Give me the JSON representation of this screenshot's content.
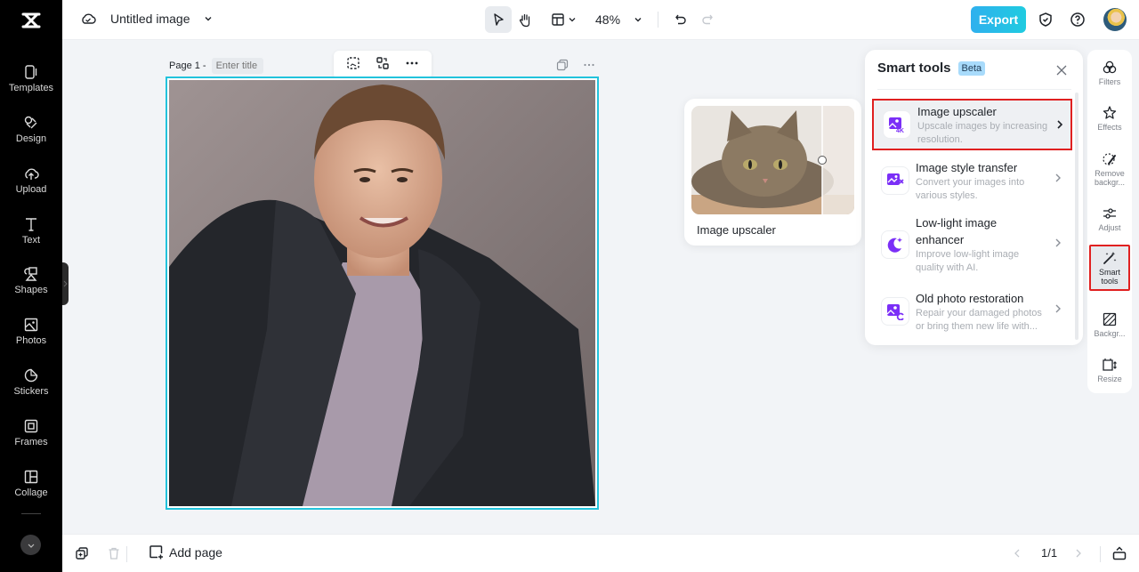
{
  "app": {
    "logo": "capcut-logo"
  },
  "header": {
    "title": "Untitled image",
    "zoom": "48%",
    "export_label": "Export"
  },
  "sidebar": {
    "items": [
      {
        "label": "Templates",
        "icon": "templates-icon"
      },
      {
        "label": "Design",
        "icon": "design-icon"
      },
      {
        "label": "Upload",
        "icon": "upload-icon"
      },
      {
        "label": "Text",
        "icon": "text-icon"
      },
      {
        "label": "Shapes",
        "icon": "shapes-icon"
      },
      {
        "label": "Photos",
        "icon": "photos-icon"
      },
      {
        "label": "Stickers",
        "icon": "stickers-icon"
      },
      {
        "label": "Frames",
        "icon": "frames-icon"
      },
      {
        "label": "Collage",
        "icon": "collage-icon"
      }
    ]
  },
  "canvas": {
    "page_label": "Page 1 -",
    "title_placeholder": "Enter title",
    "selection_color": "#22c3dc"
  },
  "preview": {
    "label": "Image upscaler"
  },
  "smart_tools": {
    "title": "Smart tools",
    "badge": "Beta",
    "items": [
      {
        "name": "Image upscaler",
        "desc": "Upscale images by increasing resolution.",
        "highlighted": true
      },
      {
        "name": "Image style transfer",
        "desc": "Convert your images into various styles.",
        "highlighted": false
      },
      {
        "name": "Low-light image enhancer",
        "desc": "Improve low-light image quality with AI.",
        "highlighted": false
      },
      {
        "name": "Old photo restoration",
        "desc": "Repair your damaged photos or bring them new life with...",
        "highlighted": false
      }
    ],
    "accent_color": "#7b2ff7",
    "highlight_color": "#e02020"
  },
  "rail": {
    "items": [
      {
        "label": "Filters"
      },
      {
        "label": "Effects"
      },
      {
        "label": "Remove backgr..."
      },
      {
        "label": "Adjust"
      },
      {
        "label": "Smart tools",
        "active": true
      },
      {
        "label": "Backgr..."
      },
      {
        "label": "Resize"
      }
    ]
  },
  "footer": {
    "add_page": "Add page",
    "page_indicator": "1/1"
  }
}
